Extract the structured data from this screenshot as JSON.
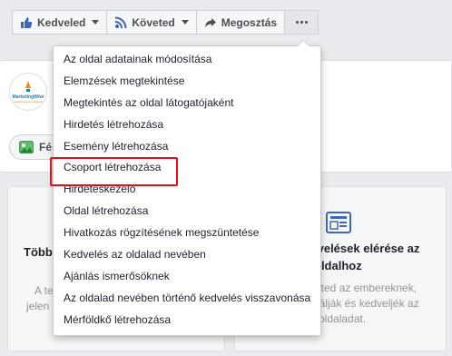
{
  "toolbar": {
    "like_label": "Kedveled",
    "follow_label": "Követed",
    "share_label": "Megosztás"
  },
  "page": {
    "logo_brand": "MarketingWiwi",
    "logo_sub": "marketingkommunikáció",
    "photo_button_label": "Fé"
  },
  "left_panel": {
    "title": "Több",
    "text_line1": "A te",
    "text_line2": "jelen"
  },
  "right_panel": {
    "title_line1": "lvelések elérése az",
    "title_line2": "oldalhoz",
    "text_line1": "eted az embereknek,",
    "text_line2": "lálják és kedveljék az",
    "text_line3": "oldaladat."
  },
  "menu": {
    "items": [
      "Az oldal adatainak módosítása",
      "Elemzések megtekintése",
      "Megtekintés az oldal látogatójaként",
      "Hirdetés létrehozása",
      "Esemény létrehozása",
      "Csoport létrehozása",
      "Hirdetéskezelő",
      "Oldal létrehozása",
      "Hivatkozás rögzítésének megszüntetése",
      "Kedvelés az oldalad nevében",
      "Ajánlás ismerősöknek",
      "Az oldalad nevében történő kedvelés visszavonása",
      "Mérföldkő létrehozása"
    ],
    "highlighted_index": 5
  },
  "colors": {
    "accent": "#4267b2",
    "highlight_border": "#e01020"
  }
}
